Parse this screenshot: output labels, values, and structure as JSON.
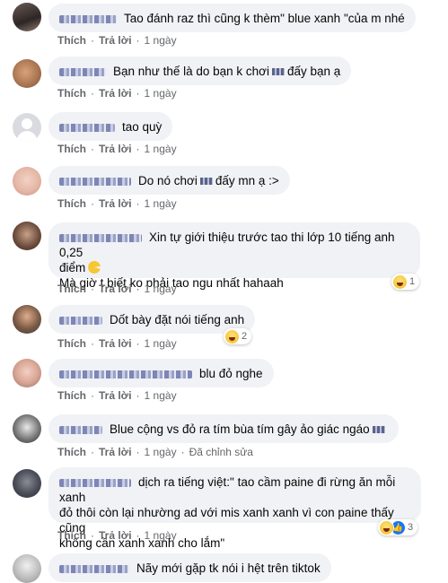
{
  "actions": {
    "like": "Thích",
    "reply": "Trả lời",
    "dot": "·",
    "edited": "Đã chỉnh sửa"
  },
  "comments": [
    {
      "text": "Tao đánh raz thì cũng k thèm\" blue xanh \"của m nhé",
      "time": "1 ngày"
    },
    {
      "text": "Bạn như thế là do bạn k chơi",
      "text2": "đấy bạn ạ",
      "time": "1 ngày"
    },
    {
      "text": "tao quỳ",
      "time": "1 ngày"
    },
    {
      "text": "Do nó chơi",
      "text2": "đấy mn ạ :>",
      "time": "1 ngày"
    },
    {
      "text": "Xin tự giới thiệu trước tao thi lớp 10 tiếng anh 0,25",
      "line2": "điểm",
      "line3": "Mà giờ t biết ko phải tao ngu nhất hahaah",
      "time": "1 ngày",
      "reactions": "1"
    },
    {
      "text": "Dốt bày đặt nói tiếng anh",
      "time": "1 ngày",
      "reactions": "2"
    },
    {
      "text": "blu đỏ nghe",
      "time": "1 ngày"
    },
    {
      "text": "Blue cộng vs đỏ ra tím bùa tím gây ảo giác ngáo",
      "time": "1 ngày"
    },
    {
      "text": "dịch ra tiếng việt:\" tao cầm paine đi rừng ăn mỗi xanh",
      "line2": "đỏ thôi còn lại nhường ad với mis xanh xanh vì con paine thấy cũng",
      "line3": "không cần xanh xanh cho lắm\"",
      "time": "1 ngày",
      "reactions": "3"
    },
    {
      "text": "Nãy mới gặp tk nói i hệt trên tiktok"
    }
  ]
}
